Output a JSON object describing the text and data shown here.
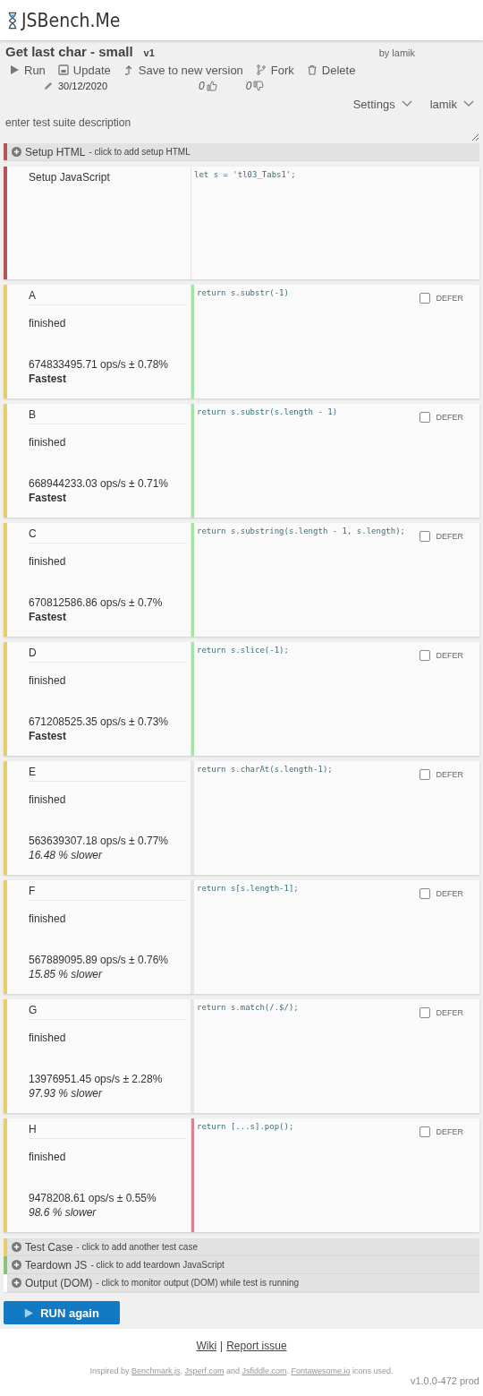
{
  "logo": {
    "text": "JSBench.Me"
  },
  "suite": {
    "title": "Get last char - small",
    "version": "v1",
    "author": "by lamik",
    "date": "30/12/2020",
    "likes": "0",
    "dislikes": "0",
    "description_placeholder": "enter test suite description"
  },
  "toolbar": [
    {
      "label": "Run",
      "kind": "play"
    },
    {
      "label": "Update",
      "kind": "save"
    },
    {
      "label": "Save to new version",
      "kind": "upload"
    },
    {
      "label": "Fork",
      "kind": "fork"
    },
    {
      "label": "Delete",
      "kind": "trash"
    }
  ],
  "menus": [
    {
      "label": "Settings"
    },
    {
      "label": "lamik"
    }
  ],
  "setup_html": {
    "title": "Setup HTML",
    "hint": "- click to add setup HTML",
    "color": "#b5545c"
  },
  "setup_js": {
    "label": "Setup JavaScript",
    "code": "let s = 'tl03_Tabs1';",
    "color": "#b5545c"
  },
  "tests": [
    {
      "name": "A",
      "status": "finished",
      "ops": "674833495.71 ops/s ± 0.78%",
      "result": "Fastest",
      "kind": "fastest",
      "code": "return s.substr(-1)",
      "color": "#a6e3a6",
      "defer": {
        "label": "DEFER",
        "checked": false
      }
    },
    {
      "name": "B",
      "status": "finished",
      "ops": "668944233.03 ops/s ± 0.71%",
      "result": "Fastest",
      "kind": "fastest",
      "code": "return s.substr(s.length - 1)",
      "color": "#a6e3a6",
      "defer": {
        "label": "DEFER",
        "checked": false
      }
    },
    {
      "name": "C",
      "status": "finished",
      "ops": "670812586.86 ops/s ± 0.7%",
      "result": "Fastest",
      "kind": "fastest",
      "code": "return s.substring(s.length - 1, s.length);",
      "color": "#a6e3a6",
      "defer": {
        "label": "DEFER",
        "checked": false
      }
    },
    {
      "name": "D",
      "status": "finished",
      "ops": "671208525.35 ops/s ± 0.73%",
      "result": "Fastest",
      "kind": "fastest",
      "code": "return s.slice(-1);",
      "color": "#a6e3a6",
      "defer": {
        "label": "DEFER",
        "checked": false
      }
    },
    {
      "name": "E",
      "status": "finished",
      "ops": "563639307.18 ops/s ± 0.77%",
      "result": "16.48 % slower",
      "kind": "slower",
      "code": "return s.charAt(s.length-1);",
      "color": "#e6e6e6",
      "defer": {
        "label": "DEFER",
        "checked": false
      }
    },
    {
      "name": "F",
      "status": "finished",
      "ops": "567889095.89 ops/s ± 0.76%",
      "result": "15.85 % slower",
      "kind": "slower",
      "code": "return s[s.length-1];",
      "color": "#e6e6e6",
      "defer": {
        "label": "DEFER",
        "checked": false
      }
    },
    {
      "name": "G",
      "status": "finished",
      "ops": "13976951.45 ops/s ± 2.28%",
      "result": "97.93 % slower",
      "kind": "slower",
      "code": "return s.match(/.$/);",
      "color": "#e6e6e6",
      "defer": {
        "label": "DEFER",
        "checked": false
      }
    },
    {
      "name": "H",
      "status": "finished",
      "ops": "9478208.61 ops/s ± 0.55%",
      "result": "98.6 % slower",
      "kind": "slower",
      "code": "return [...s].pop();",
      "color": "#d9838a",
      "defer": {
        "label": "DEFER",
        "checked": false
      }
    }
  ],
  "add_bars": [
    {
      "title": "Test Case",
      "hint": "- click to add another test case",
      "color": "#e6cf6a"
    },
    {
      "title": "Teardown JS",
      "hint": "- click to add teardown JavaScript",
      "color": "#8cc17a"
    },
    {
      "title": "Output (DOM)",
      "hint": "- click to monitor output (DOM) while test is running",
      "color": "#ffffff"
    }
  ],
  "run_button": {
    "label": "RUN again"
  },
  "footer": {
    "links": [
      "Wiki",
      "Report issue"
    ],
    "separator": "|",
    "credits": [
      {
        "text": "Inspired by ",
        "kind": "text"
      },
      {
        "text": "Benchmark.js",
        "kind": "link"
      },
      {
        "text": ", ",
        "kind": "text"
      },
      {
        "text": "Jsperf.com",
        "kind": "link"
      },
      {
        "text": " and ",
        "kind": "text"
      },
      {
        "text": "Jsfiddle.com",
        "kind": "link"
      },
      {
        "text": ". ",
        "kind": "text"
      },
      {
        "text": "Fontawesome.io",
        "kind": "link"
      },
      {
        "text": " icons used.",
        "kind": "text"
      }
    ],
    "version": "v1.0.0-472 prod"
  }
}
